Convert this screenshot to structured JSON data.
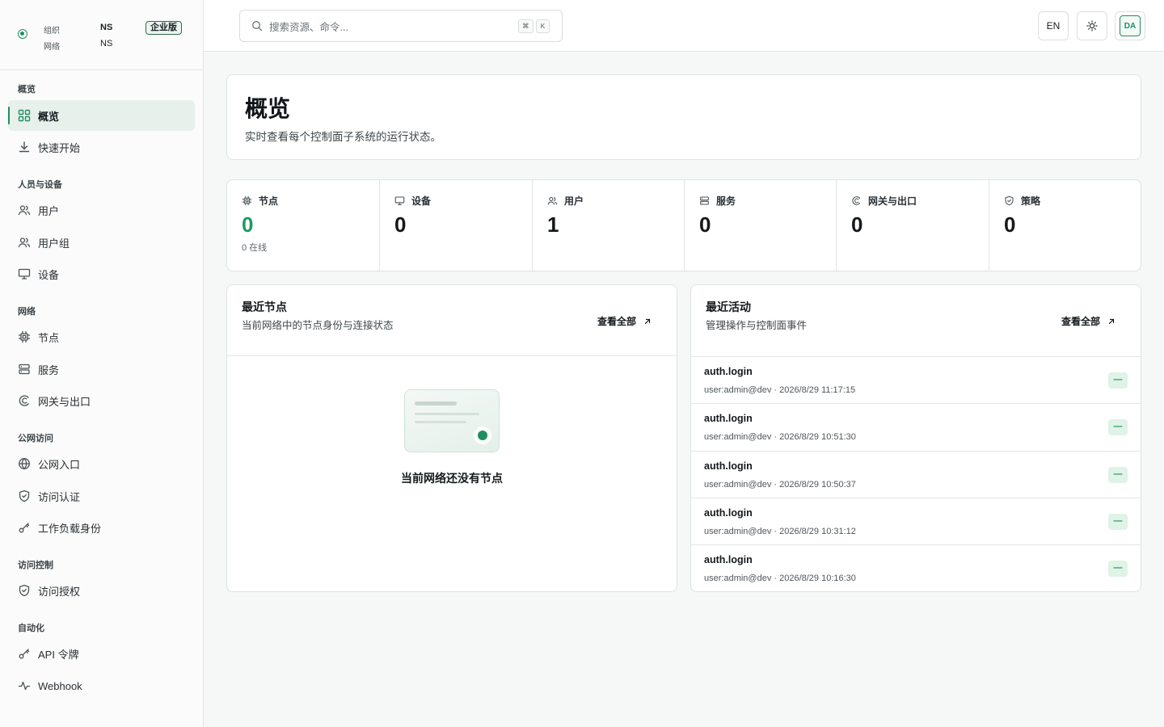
{
  "org": {
    "org_label": "组织",
    "org_value": "NS",
    "network_label": "网络",
    "network_value": "NS",
    "edition_badge": "企业版",
    "status_color": "#1f8f5f"
  },
  "sidebar": {
    "sections": [
      {
        "title": "概览",
        "items": [
          {
            "label": "概览",
            "icon": "dashboard-grid-icon",
            "active": true
          },
          {
            "label": "快速开始",
            "icon": "download-icon"
          }
        ]
      },
      {
        "title": "人员与设备",
        "items": [
          {
            "label": "用户",
            "icon": "users-icon"
          },
          {
            "label": "用户组",
            "icon": "user-group-icon"
          },
          {
            "label": "设备",
            "icon": "monitor-icon"
          }
        ]
      },
      {
        "title": "网络",
        "items": [
          {
            "label": "节点",
            "icon": "chip-icon"
          },
          {
            "label": "服务",
            "icon": "server-icon"
          },
          {
            "label": "网关与出口",
            "icon": "gateway-icon"
          }
        ]
      },
      {
        "title": "公网访问",
        "items": [
          {
            "label": "公网入口",
            "icon": "globe-icon"
          },
          {
            "label": "访问认证",
            "icon": "shield-icon"
          },
          {
            "label": "工作负载身份",
            "icon": "key-icon"
          }
        ]
      },
      {
        "title": "访问控制",
        "items": [
          {
            "label": "访问授权",
            "icon": "shield-check-icon"
          }
        ]
      },
      {
        "title": "自动化",
        "items": [
          {
            "label": "API 令牌",
            "icon": "key-icon"
          },
          {
            "label": "Webhook",
            "icon": "activity-icon"
          }
        ]
      }
    ]
  },
  "header": {
    "search_placeholder": "搜索资源、命令...",
    "kbd_1": "⌘",
    "kbd_2": "K",
    "lang_button": "EN",
    "avatar_initials": "DA"
  },
  "page": {
    "title": "概览",
    "subtitle": "实时查看每个控制面子系统的运行状态。"
  },
  "stats": [
    {
      "label": "节点",
      "icon": "chip-icon",
      "value": "0",
      "note": "0 在线",
      "highlight": true
    },
    {
      "label": "设备",
      "icon": "monitor-icon",
      "value": "0"
    },
    {
      "label": "用户",
      "icon": "users-icon",
      "value": "1"
    },
    {
      "label": "服务",
      "icon": "server-icon",
      "value": "0"
    },
    {
      "label": "网关与出口",
      "icon": "gateway-icon",
      "value": "0"
    },
    {
      "label": "策略",
      "icon": "shield-icon",
      "value": "0"
    }
  ],
  "recent_nodes": {
    "title": "最近节点",
    "subtitle": "当前网络中的节点身份与连接状态",
    "link": "查看全部",
    "empty_text": "当前网络还没有节点"
  },
  "recent_activity": {
    "title": "最近活动",
    "subtitle": "管理操作与控制面事件",
    "link": "查看全部",
    "items": [
      {
        "event": "auth.login",
        "meta": "user:admin@dev · 2026/8/29 11:17:15",
        "status": "—"
      },
      {
        "event": "auth.login",
        "meta": "user:admin@dev · 2026/8/29 10:51:30",
        "status": "—"
      },
      {
        "event": "auth.login",
        "meta": "user:admin@dev · 2026/8/29 10:50:37",
        "status": "—"
      },
      {
        "event": "auth.login",
        "meta": "user:admin@dev · 2026/8/29 10:31:12",
        "status": "—"
      },
      {
        "event": "auth.login",
        "meta": "user:admin@dev · 2026/8/29 10:16:30",
        "status": "—"
      }
    ]
  },
  "colors": {
    "accent": "#1f8f5f",
    "stat_highlight": "#1f9a62",
    "badge_bg": "#dff3e7"
  }
}
